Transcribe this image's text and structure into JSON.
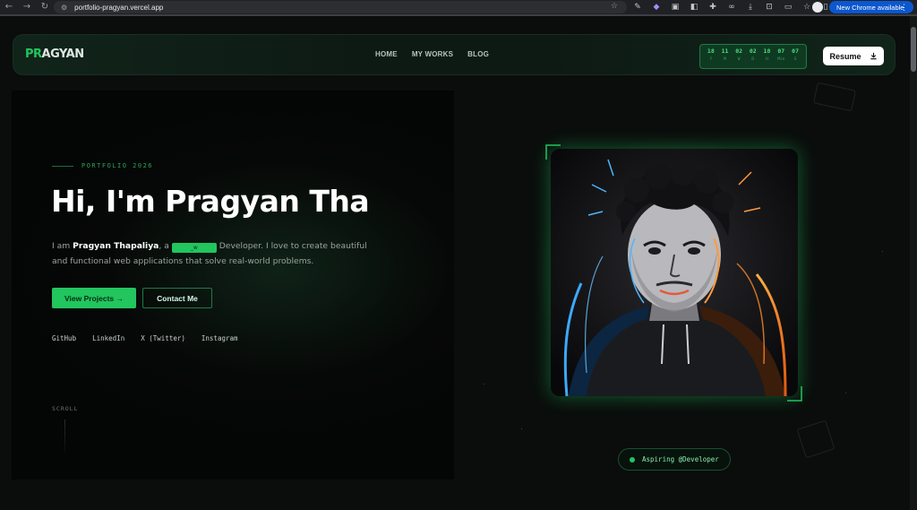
{
  "browser": {
    "url": "portfolio-pragyan.vercel.app",
    "update_label": "New Chrome available",
    "profile_badge": "2"
  },
  "brand": {
    "logo_primary": "PR",
    "logo_rest": "AGYAN",
    "accent": "#22c55e"
  },
  "nav": {
    "items": [
      {
        "label": "HOME"
      },
      {
        "label": "MY WORKS"
      },
      {
        "label": "BLOG"
      }
    ],
    "clock": [
      {
        "value": "18",
        "unit": "Y"
      },
      {
        "value": "11",
        "unit": "M"
      },
      {
        "value": "02",
        "unit": "W"
      },
      {
        "value": "02",
        "unit": "D"
      },
      {
        "value": "18",
        "unit": "H"
      },
      {
        "value": "07",
        "unit": "Min"
      },
      {
        "value": "07",
        "unit": "S"
      }
    ],
    "resume_label": "Resume"
  },
  "hero": {
    "eyebrow": "PORTFOLIO 2026",
    "headline": "Hi, I'm Pragyan Tha",
    "intro_prefix": "I am ",
    "intro_name": "Pragyan Thapaliya",
    "intro_mid": ", a ",
    "role_chip": "_w",
    "intro_suffix": " Developer. I love to create beautiful and functional web applications that solve real-world problems.",
    "primary_cta": "View Projects →",
    "secondary_cta": "Contact Me",
    "socials": [
      {
        "label": "GitHub"
      },
      {
        "label": "LinkedIn"
      },
      {
        "label": "X (Twitter)"
      },
      {
        "label": "Instagram"
      }
    ],
    "scroll_label": "SCROLL"
  },
  "badge": {
    "label": "Aspiring @Developer"
  }
}
